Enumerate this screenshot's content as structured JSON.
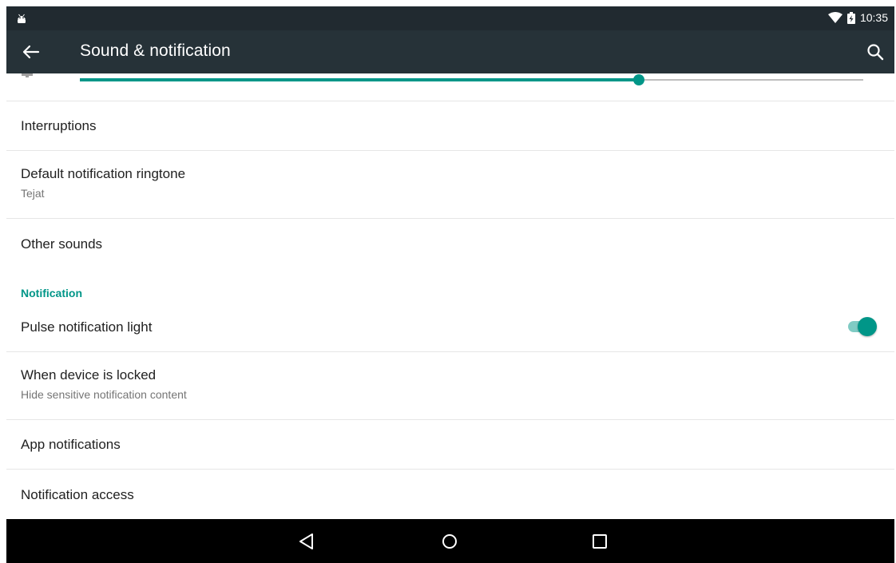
{
  "status_bar": {
    "time": "10:35"
  },
  "app_bar": {
    "title": "Sound & notification"
  },
  "volume_slider": {
    "level": 0.714
  },
  "items": [
    {
      "title": "Interruptions"
    },
    {
      "title": "Default notification ringtone",
      "subtitle": "Tejat"
    },
    {
      "title": "Other sounds"
    }
  ],
  "notification_section": {
    "header": "Notification",
    "pulse": {
      "title": "Pulse notification light",
      "enabled": true
    },
    "locked": {
      "title": "When device is locked",
      "subtitle": "Hide sensitive notification content"
    },
    "app_notifications": {
      "title": "App notifications"
    },
    "notification_access": {
      "title": "Notification access"
    }
  },
  "colors": {
    "accent": "#009688",
    "toolbar": "#263238",
    "status_bar": "#212a30"
  },
  "icons": [
    "android-icon",
    "wifi-icon",
    "battery-charging-icon",
    "back-arrow-icon",
    "search-icon",
    "bell-icon",
    "back-nav-icon",
    "home-nav-icon",
    "recents-nav-icon"
  ]
}
